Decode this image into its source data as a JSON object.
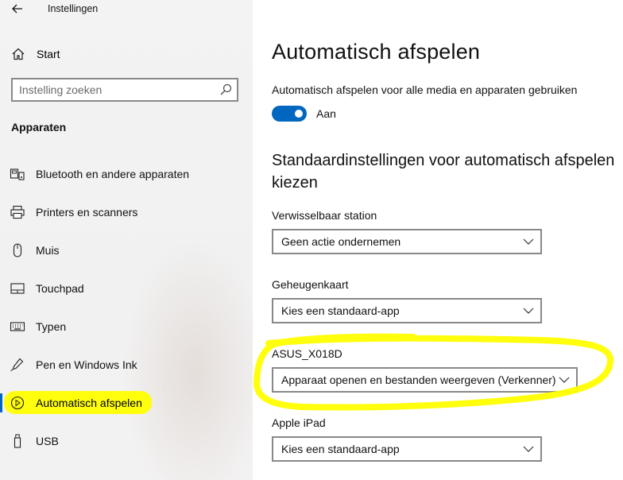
{
  "window": {
    "title": "Instellingen"
  },
  "sidebar": {
    "home_label": "Start",
    "search": {
      "placeholder": "Instelling zoeken"
    },
    "section_title": "Apparaten",
    "items": [
      {
        "label": "Bluetooth en andere apparaten",
        "icon": "bluetooth-devices-icon"
      },
      {
        "label": "Printers en scanners",
        "icon": "printer-icon"
      },
      {
        "label": "Muis",
        "icon": "mouse-icon"
      },
      {
        "label": "Touchpad",
        "icon": "touchpad-icon"
      },
      {
        "label": "Typen",
        "icon": "keyboard-icon"
      },
      {
        "label": "Pen en Windows Ink",
        "icon": "pen-icon"
      },
      {
        "label": "Automatisch afspelen",
        "icon": "autoplay-icon",
        "selected": true
      },
      {
        "label": "USB",
        "icon": "usb-icon"
      }
    ]
  },
  "main": {
    "title": "Automatisch afspelen",
    "toggle": {
      "description": "Automatisch afspelen voor alle media en apparaten gebruiken",
      "state_label": "Aan",
      "on": true
    },
    "subheading": "Standaardinstellingen voor automatisch afspelen kiezen",
    "devices": [
      {
        "label": "Verwisselbaar station",
        "value": "Geen actie ondernemen"
      },
      {
        "label": "Geheugenkaart",
        "value": "Kies een standaard-app"
      },
      {
        "label": "ASUS_X018D",
        "value": "Apparaat openen en bestanden weergeven (Verkenner)"
      },
      {
        "label": "Apple iPad",
        "value": "Kies een standaard-app"
      }
    ]
  },
  "colors": {
    "accent": "#0067c0",
    "highlight": "#ffff00"
  }
}
